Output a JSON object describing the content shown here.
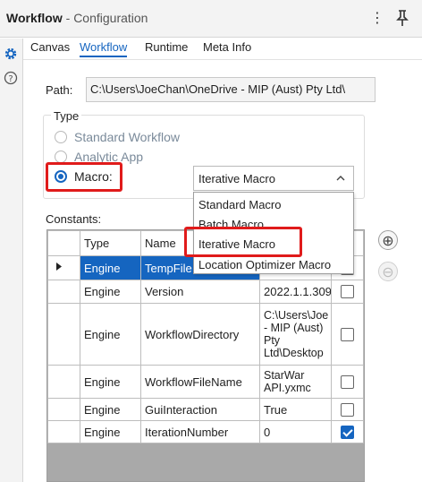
{
  "window": {
    "title_bold": "Workflow",
    "title_rest": " - Configuration",
    "kebab_glyph": "⋮"
  },
  "tabs": [
    "Canvas",
    "Workflow",
    "Runtime",
    "Meta Info"
  ],
  "active_tab": "Workflow",
  "path": {
    "label": "Path:",
    "value": "C:\\Users\\JoeChan\\OneDrive - MIP (Aust) Pty Ltd\\"
  },
  "type_group": {
    "legend": "Type",
    "options": {
      "standard": "Standard Workflow",
      "analytic": "Analytic App",
      "macro": "Macro:"
    },
    "selected": "Macro:"
  },
  "macro_select": {
    "value": "Iterative Macro",
    "options": [
      "Standard Macro",
      "Batch Macro",
      "Iterative Macro",
      "Location Optimizer Macro"
    ]
  },
  "constants": {
    "label": "Constants:",
    "headers": {
      "type": "Type",
      "name": "Name"
    },
    "rows": [
      {
        "type": "Engine",
        "name": "TempFile",
        "value": "",
        "checked": false
      },
      {
        "type": "Engine",
        "name": "Version",
        "value": "2022.1.1.309",
        "checked": false
      },
      {
        "type": "Engine",
        "name": "WorkflowDirectory",
        "value": "C:\\Users\\Joe - MIP (Aust) Pty Ltd\\Desktop",
        "checked": false
      },
      {
        "type": "Engine",
        "name": "WorkflowFileName",
        "value": "StarWar API.yxmc",
        "checked": false
      },
      {
        "type": "Engine",
        "name": "GuiInteraction",
        "value": "True",
        "checked": false
      },
      {
        "type": "Engine",
        "name": "IterationNumber",
        "value": "0",
        "checked": true
      }
    ]
  },
  "side_buttons": {
    "add": "⊕",
    "remove": "⊖"
  },
  "colors": {
    "accent": "#1565c0",
    "highlight": "#e01b1b",
    "grid_empty": "#a9a9a9"
  },
  "icons": [
    "gear-icon",
    "help-icon",
    "pin-icon",
    "kebab-menu-icon",
    "chevron-up-icon",
    "row-pointer-icon"
  ]
}
